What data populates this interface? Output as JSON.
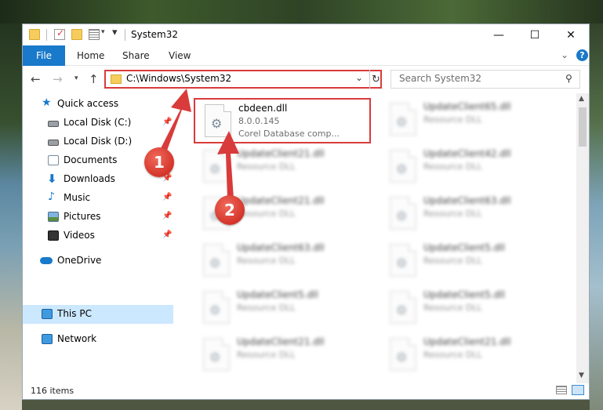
{
  "window": {
    "title": "System32",
    "buttons": {
      "minimize": "—",
      "maximize": "☐",
      "close": "✕"
    }
  },
  "ribbon": {
    "tabs": [
      "File",
      "Home",
      "Share",
      "View"
    ],
    "help": "?"
  },
  "address": {
    "path": "C:\\Windows\\System32",
    "search_placeholder": "Search System32"
  },
  "nav": {
    "items": [
      {
        "label": "Quick access",
        "icon": "star-icon"
      },
      {
        "label": "Local Disk (C:)",
        "icon": "drive-icon",
        "pinned": true
      },
      {
        "label": "Local Disk (D:)",
        "icon": "drive-icon"
      },
      {
        "label": "Documents",
        "icon": "documents-icon"
      },
      {
        "label": "Downloads",
        "icon": "download-icon",
        "pinned": true
      },
      {
        "label": "Music",
        "icon": "music-icon",
        "pinned": true
      },
      {
        "label": "Pictures",
        "icon": "pictures-icon",
        "pinned": true
      },
      {
        "label": "Videos",
        "icon": "videos-icon",
        "pinned": true
      },
      {
        "label": "OneDrive",
        "icon": "cloud-icon"
      },
      {
        "label": "This PC",
        "icon": "computer-icon",
        "selected": true
      },
      {
        "label": "Network",
        "icon": "network-icon"
      }
    ]
  },
  "files": {
    "highlighted": {
      "name": "cbdeen.dll",
      "version": "8.0.0.145",
      "description": "Corel Database comp..."
    },
    "left_column": [
      {
        "name": "UpdateClient21.dll",
        "type": "Resource DLL"
      },
      {
        "name": "UpdateClient21.dll",
        "type": "Resource DLL"
      },
      {
        "name": "UpdateClient63.dll",
        "type": "Resource DLL"
      },
      {
        "name": "UpdateClient5.dll",
        "type": "Resource DLL"
      },
      {
        "name": "UpdateClient21.dll",
        "type": "Resource DLL"
      }
    ],
    "right_column": [
      {
        "name": "UpdateClient65.dll",
        "type": "Resource DLL"
      },
      {
        "name": "UpdateClient42.dll",
        "type": "Resource DLL"
      },
      {
        "name": "UpdateClient63.dll",
        "type": "Resource DLL"
      },
      {
        "name": "UpdateClient5.dll",
        "type": "Resource DLL"
      },
      {
        "name": "UpdateClient5.dll",
        "type": "Resource DLL"
      },
      {
        "name": "UpdateClient21.dll",
        "type": "Resource DLL"
      }
    ]
  },
  "status": {
    "item_count": "116 items"
  },
  "annotations": {
    "step1": "1",
    "step2": "2",
    "color": "#d93b3b"
  }
}
